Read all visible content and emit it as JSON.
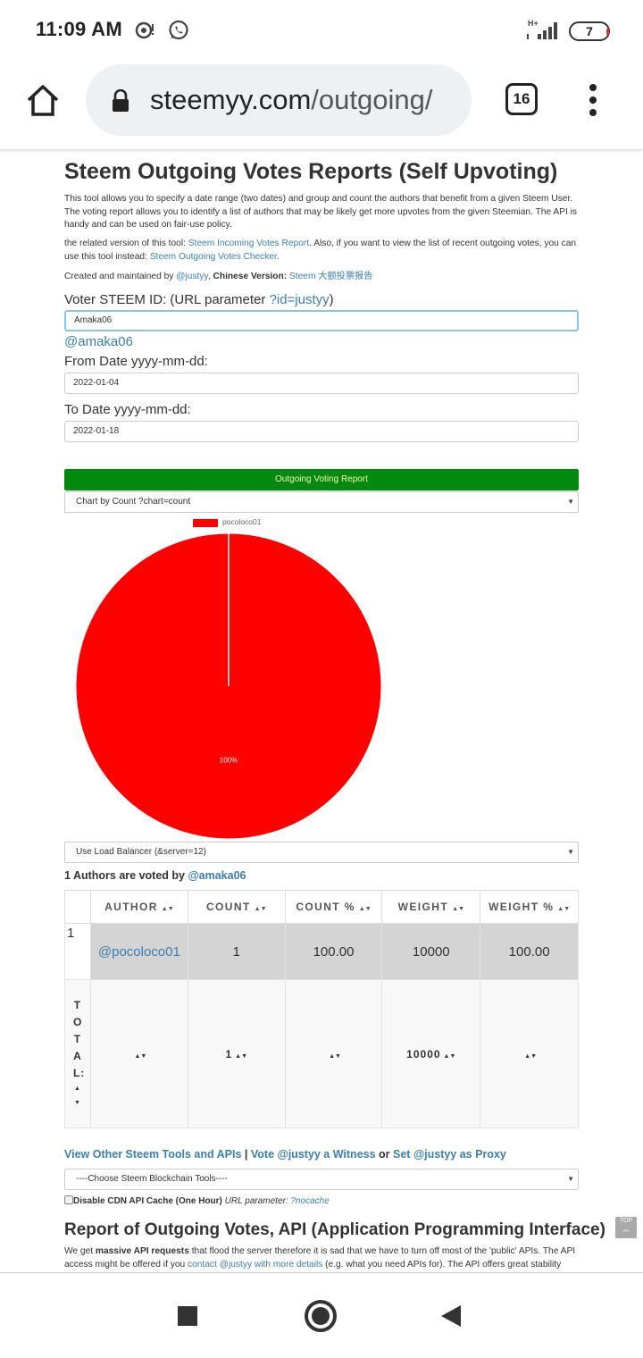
{
  "status": {
    "time": "11:09 AM",
    "network": "H+",
    "battery": "7"
  },
  "browser": {
    "domain": "steemyy.com",
    "path": "/outgoing/",
    "tab_count": "16"
  },
  "page": {
    "title": "Steem Outgoing Votes Reports (Self Upvoting)",
    "intro": "This tool allows you to specify a date range (two dates) and group and count the authors that benefit from a given Steem User. The voting report allows you to identify a list of authors that may be likely get more upvotes from the given Steemian. The API is handy and can be used on fair-use policy.",
    "related_prefix": "the related version of this tool: ",
    "related_link": "Steem Incoming Votes Report",
    "related_middle": ". Also, if you want to view the list of recent outgoing votes, you can use this tool instead: ",
    "related_link2": "Steem Outgoing Votes Checker",
    "related_suffix": ".",
    "created_prefix": "Created and maintained by ",
    "created_link": "@justyy",
    "created_middle": ", ",
    "created_bold": "Chinese Version:",
    "created_link2": " Steem 大额投票报告",
    "voter_label": "Voter STEEM ID: (URL parameter ",
    "voter_param": "?id=justyy",
    "voter_label_end": ")",
    "voter_value": "Amaka06",
    "voter_link": "@amaka06",
    "from_label": "From Date yyyy-mm-dd:",
    "from_value": "2022-01-04",
    "to_label": "To Date yyyy-mm-dd:",
    "to_value": "2022-01-18",
    "report_button": "Outgoing Voting Report",
    "chart_select": "Chart by Count ?chart=count",
    "server_select": "Use Load Balancer (&server=12)",
    "authors_prefix": "1 Authors are voted by ",
    "authors_link": "@amaka06",
    "tools_link1": "View Other Steem Tools and APIs",
    "tools_sep1": " | ",
    "tools_link2": "Vote @justyy a Witness",
    "tools_sep2": " or ",
    "tools_link3": "Set @justyy as Proxy",
    "tools_select": "----Choose Steem Blockchain Tools----",
    "cdn_label": "Disable CDN API Cache (One Hour)",
    "cdn_param_label": " URL parameter: ",
    "cdn_param": "?nocache",
    "api_title": "Report of Outgoing Votes, API (Application Programming Interface)",
    "api_p1": "We get ",
    "api_bold": "massive API requests",
    "api_p2": " that flood the server therefore it is sad that we have to turn off most of the 'public' APIs. The API access might be offered if you ",
    "api_link": "contact @justyy with more details",
    "api_p3": " (e.g. what you need APIs for). The API offers great stability",
    "top_label": "TOP"
  },
  "table": {
    "headers": [
      "AUTHOR",
      "COUNT",
      "COUNT %",
      "WEIGHT",
      "WEIGHT %"
    ],
    "sort_glyph": "▲▼",
    "rows": [
      {
        "index": "1",
        "author": "@pocoloco01",
        "count": "1",
        "count_pct": "100.00",
        "weight": "10000",
        "weight_pct": "100.00"
      }
    ],
    "total": {
      "label": "TOTAL:",
      "count": "1",
      "weight": "10000"
    }
  },
  "chart_data": {
    "type": "pie",
    "categories": [
      "pocoloco01"
    ],
    "values": [
      1
    ],
    "labels": [
      "100%"
    ],
    "colors": [
      "#ff0000"
    ]
  }
}
